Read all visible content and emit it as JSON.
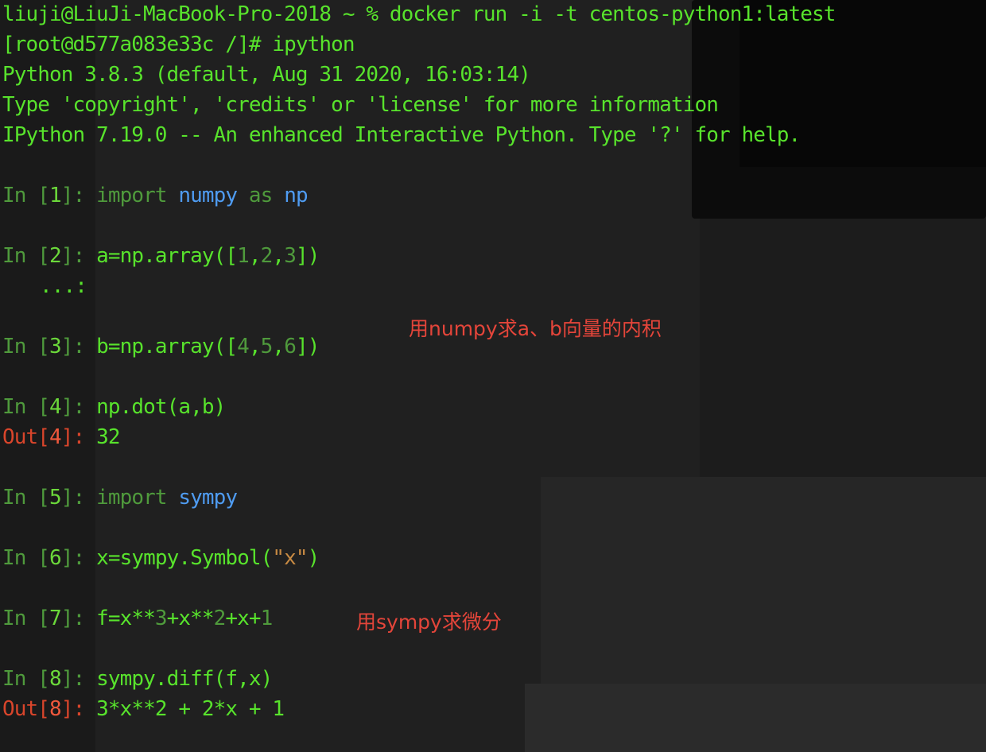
{
  "colors": {
    "terminal_text": "#58e32c",
    "prompt_number": "#6bd83a",
    "prompt_label": "#4f9a3c",
    "keyword_module": "#4f9cf2",
    "out_label": "#d9452b",
    "string": "#c78a43",
    "annotation": "#e4453a"
  },
  "header": {
    "command_line": "liuji@LiuJi-MacBook-Pro-2018 ~ % docker run -i -t centos-python1:latest",
    "root_prompt": "[root@d577a083e33c /]# ipython",
    "python_version": "Python 3.8.3 (default, Aug 31 2020, 16:03:14)",
    "type_hint": "Type 'copyright', 'credits' or 'license' for more information",
    "ipython_banner": "IPython 7.19.0 -- An enhanced Interactive Python. Type '?' for help."
  },
  "prompt": {
    "in_label": "In ",
    "out_label": "Out",
    "open": "[",
    "close": "]",
    "colon": ": "
  },
  "cells": {
    "c1": {
      "n": "1",
      "kw": "import",
      "mod": "numpy",
      "as": "as",
      "alias": "np"
    },
    "c2": {
      "n": "2",
      "pre": "a=np.array([",
      "v1": "1",
      "v2": "2",
      "v3": "3",
      "post": "])",
      "cont": "...:"
    },
    "c3": {
      "n": "3",
      "pre": "b=np.array([",
      "v1": "4",
      "v2": "5",
      "v3": "6",
      "post": "])"
    },
    "c4": {
      "n": "4",
      "code": "np.dot(a,b)",
      "out": "32"
    },
    "c5": {
      "n": "5",
      "kw": "import",
      "mod": "sympy"
    },
    "c6": {
      "n": "6",
      "pre": "x=sympy.Symbol(",
      "str": "\"x\"",
      "post": ")"
    },
    "c7": {
      "n": "7",
      "p1": "f=x**",
      "e1": "3",
      "p2": "+x**",
      "e2": "2",
      "p3": "+x+",
      "e3": "1"
    },
    "c8": {
      "n": "8",
      "code": "sympy.diff(f,x)",
      "out": "3*x**2 + 2*x + 1"
    }
  },
  "annotations": {
    "numpy_note": "用numpy求a、b向量的内积",
    "sympy_note": "用sympy求微分"
  }
}
